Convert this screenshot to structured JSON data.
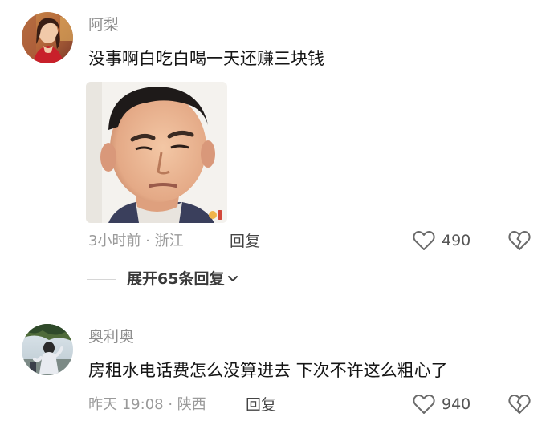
{
  "comments": [
    {
      "username": "阿梨",
      "text": "没事啊白吃白喝一天还赚三块钱",
      "meta": "3小时前 · 浙江",
      "reply_label": "回复",
      "likes": "490",
      "expand_label": "展开65条回复"
    },
    {
      "username": "奥利奥",
      "text": "房租水电话费怎么没算进去 下次不许这么粗心了",
      "meta": "昨天 19:08 · 陕西",
      "reply_label": "回复",
      "likes": "940"
    }
  ],
  "icons": {
    "like": "heart-outline-icon",
    "dislike": "broken-heart-icon",
    "expand": "chevron-down-icon"
  },
  "colors": {
    "text_primary": "#161616",
    "text_secondary": "#9a9a9a",
    "username": "#8e8e8e"
  }
}
